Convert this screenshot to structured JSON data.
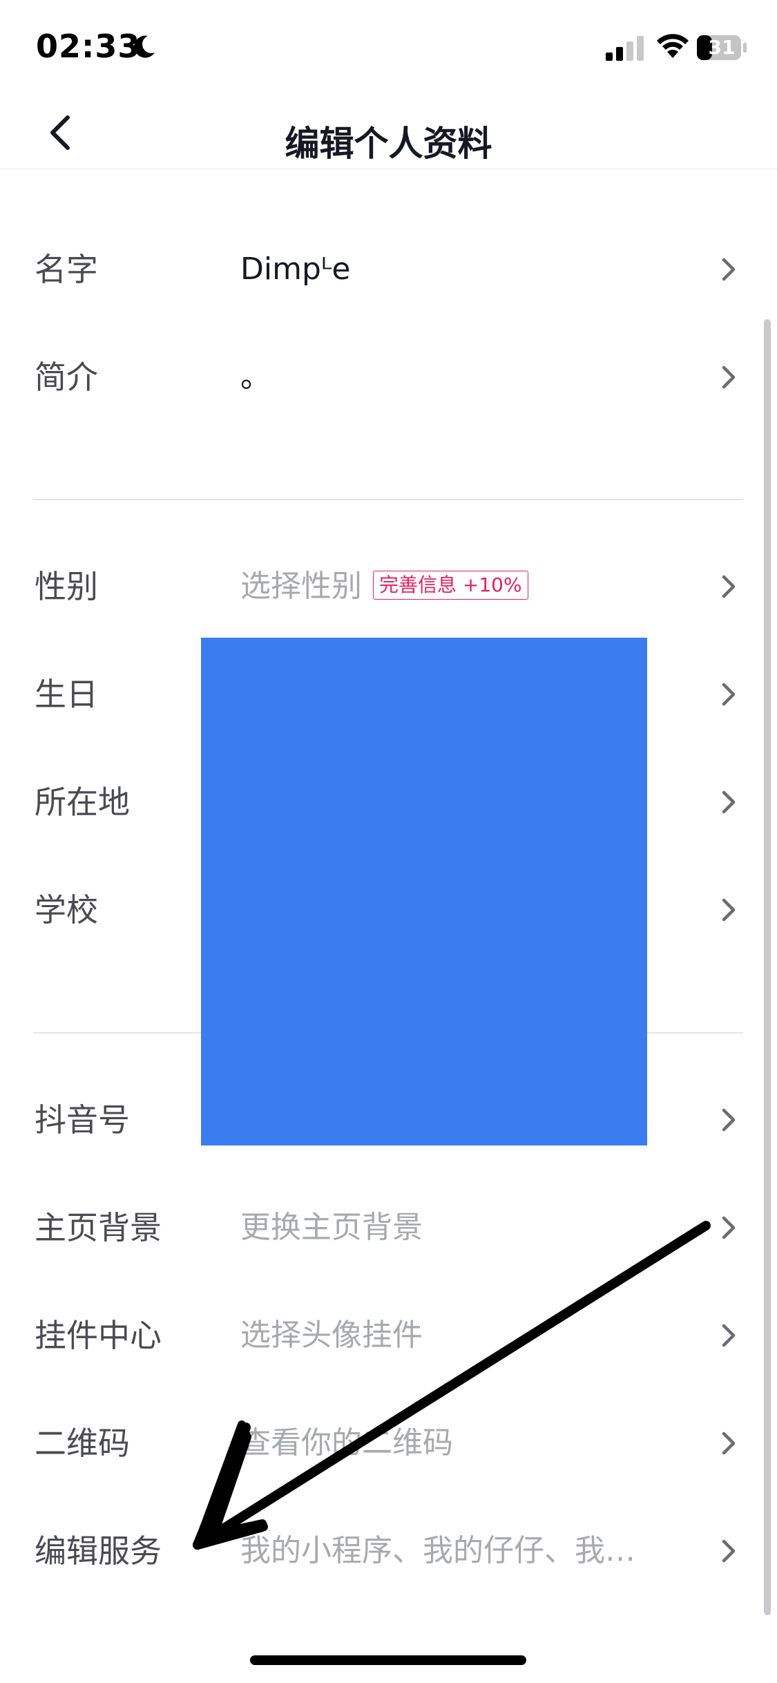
{
  "status_bar": {
    "time": "02:33",
    "battery": "31"
  },
  "nav": {
    "title": "编辑个人资料"
  },
  "profile": {
    "name_label": "名字",
    "name_value": "Dimpᴸe",
    "bio_label": "简介",
    "bio_value": "。"
  },
  "details": {
    "gender_label": "性别",
    "gender_placeholder": "选择性别",
    "gender_badge": "完善信息 +10%",
    "birthday_label": "生日",
    "location_label": "所在地",
    "school_label": "学校"
  },
  "more": {
    "douyin_id_label": "抖音号",
    "background_label": "主页背景",
    "background_placeholder": "更换主页背景",
    "pendant_label": "挂件中心",
    "pendant_placeholder": "选择头像挂件",
    "qrcode_label": "二维码",
    "qrcode_placeholder": "查看你的二维码",
    "services_label": "编辑服务",
    "services_placeholder": "我的小程序、我的仔仔、我…"
  },
  "colors": {
    "badge": "#e0245e",
    "redaction": "#3b7cf0"
  }
}
